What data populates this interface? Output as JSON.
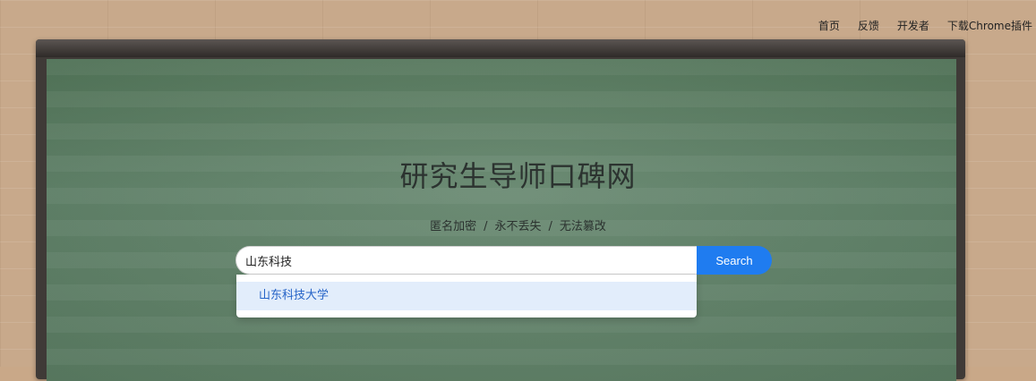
{
  "nav": {
    "items": [
      {
        "label": "首页"
      },
      {
        "label": "反馈"
      },
      {
        "label": "开发者"
      },
      {
        "label": "下载Chrome插件"
      }
    ]
  },
  "hero": {
    "title": "研究生导师口碑网",
    "slogan": [
      "匿名加密",
      "永不丢失",
      "无法篡改"
    ],
    "separator": "/"
  },
  "search": {
    "value": "山东科技",
    "button_label": "Search",
    "suggestions": [
      {
        "label": "山东科技大学"
      }
    ]
  },
  "colors": {
    "button": "#1f7cf0",
    "suggestion_highlight": "#e2edfb",
    "suggestion_text": "#2563c7",
    "board": "#5a7c62"
  }
}
